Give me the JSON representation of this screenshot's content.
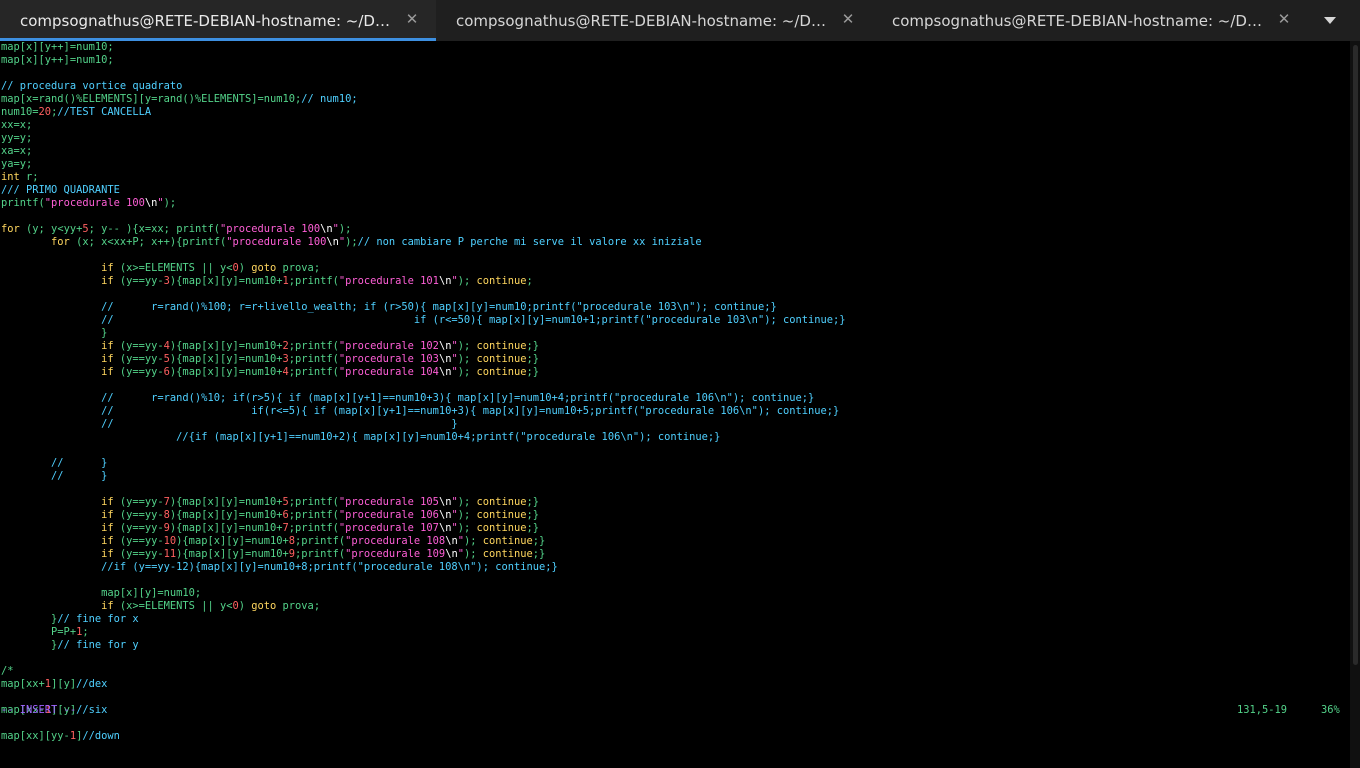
{
  "tabs": [
    {
      "label": "compsognathus@RETE-DEBIAN-hostname: ~/Docume…",
      "active": true
    },
    {
      "label": "compsognathus@RETE-DEBIAN-hostname: ~/Docume…",
      "active": false
    },
    {
      "label": "compsognathus@RETE-DEBIAN-hostname: ~/Docume…",
      "active": false
    }
  ],
  "editor": {
    "lines": [
      "map[x][y++]=num10;",
      "map[x][y++]=num10;",
      "",
      "// procedura vortice quadrato",
      "map[x=rand()%ELEMENTS][y=rand()%ELEMENTS]=num10;// num10;",
      "num10=20;//TEST CANCELLA",
      "xx=x;",
      "yy=y;",
      "xa=x;",
      "ya=y;",
      "int r;",
      "/// PRIMO QUADRANTE",
      "printf(\"procedurale 100\\n\");",
      "",
      "for (y; y<yy+5; y-- ){x=xx; printf(\"procedurale 100\\n\");",
      "        for (x; x<xx+P; x++){printf(\"procedurale 100\\n\");// non cambiare P perche mi serve il valore xx iniziale",
      "",
      "                if (x>=ELEMENTS || y<0) goto prova;",
      "                if (y==yy-3){map[x][y]=num10+1;printf(\"procedurale 101\\n\"); continue;",
      "",
      "                //      r=rand()%100; r=r+livello_wealth; if (r>50){ map[x][y]=num10;printf(\"procedurale 103\\n\"); continue;}",
      "                //                                                if (r<=50){ map[x][y]=num10+1;printf(\"procedurale 103\\n\"); continue;}",
      "                }",
      "                if (y==yy-4){map[x][y]=num10+2;printf(\"procedurale 102\\n\"); continue;}",
      "                if (y==yy-5){map[x][y]=num10+3;printf(\"procedurale 103\\n\"); continue;}",
      "                if (y==yy-6){map[x][y]=num10+4;printf(\"procedurale 104\\n\"); continue;}",
      "",
      "                //      r=rand()%10; if(r>5){ if (map[x][y+1]==num10+3){ map[x][y]=num10+4;printf(\"procedurale 106\\n\"); continue;}",
      "                //                      if(r<=5){ if (map[x][y+1]==num10+3){ map[x][y]=num10+5;printf(\"procedurale 106\\n\"); continue;}",
      "                //                                                      }",
      "                            //{if (map[x][y+1]==num10+2){ map[x][y]=num10+4;printf(\"procedurale 106\\n\"); continue;}",
      "",
      "        //      }",
      "        //      }",
      "",
      "                if (y==yy-7){map[x][y]=num10+5;printf(\"procedurale 105\\n\"); continue;}",
      "                if (y==yy-8){map[x][y]=num10+6;printf(\"procedurale 106\\n\"); continue;}",
      "                if (y==yy-9){map[x][y]=num10+7;printf(\"procedurale 107\\n\"); continue;}",
      "                if (y==yy-10){map[x][y]=num10+8;printf(\"procedurale 108\\n\"); continue;}",
      "                if (y==yy-11){map[x][y]=num10+9;printf(\"procedurale 109\\n\"); continue;}",
      "                //if (y==yy-12){map[x][y]=num10+8;printf(\"procedurale 108\\n\"); continue;}",
      "",
      "                map[x][y]=num10;",
      "                if (x>=ELEMENTS || y<0) goto prova;",
      "        }// fine for x",
      "        P=P+1;",
      "        }// fine for y",
      "",
      "/*",
      "map[xx+1][y]//dex",
      "",
      "map[xx-1][y]//six",
      "",
      "map[xx][yy-1]//down"
    ]
  },
  "status": {
    "mode": "-- INSERT --",
    "position": "131,5-19",
    "percent": "36%"
  },
  "colors": {
    "default": "#53d38a",
    "comment": "#4fd0ff",
    "string": "#ff5fd7",
    "keyword": "#ffd75f",
    "number": "#ff6060",
    "mode": "#a060ff",
    "tab_indicator": "#3d8fe0"
  },
  "icons": {
    "tab_close": "close-icon",
    "menu": "chevron-down-icon"
  }
}
